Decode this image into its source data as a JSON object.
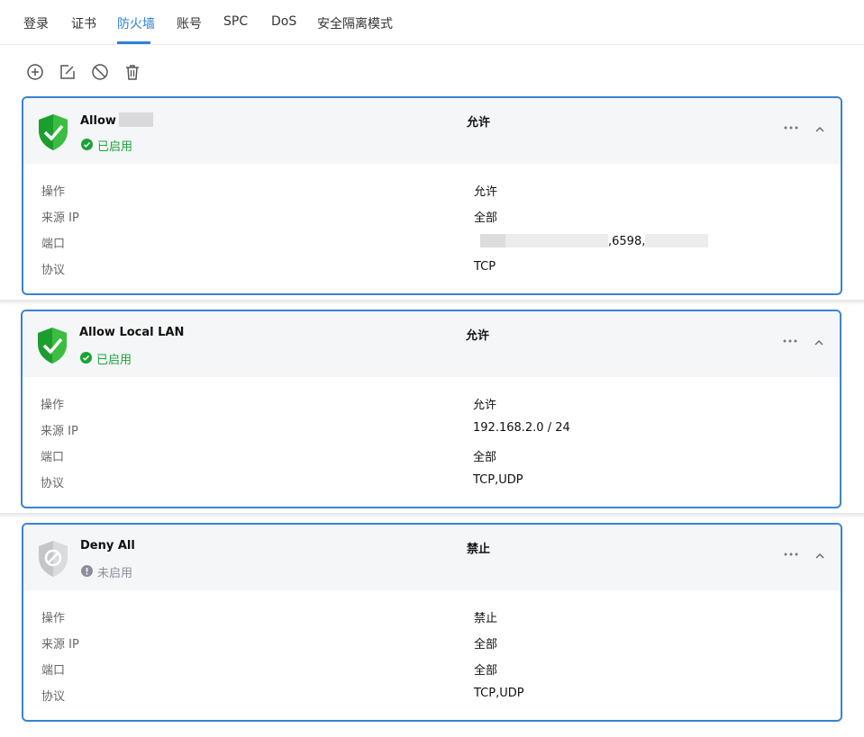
{
  "tabs": [
    {
      "label": "登录",
      "active": false
    },
    {
      "label": "证书",
      "active": false
    },
    {
      "label": "防火墙",
      "active": true
    },
    {
      "label": "账号",
      "active": false
    },
    {
      "label": "SPC",
      "active": false
    },
    {
      "label": "DoS",
      "active": false
    },
    {
      "label": "安全隔离模式",
      "active": false
    }
  ],
  "toolbar": {
    "icons": [
      "add-icon",
      "edit-icon",
      "disable-icon",
      "delete-icon"
    ]
  },
  "labels": {
    "action": "操作",
    "source_ip": "来源 IP",
    "port": "端口",
    "protocol": "协议"
  },
  "rules": [
    {
      "name": "Allow",
      "status": "已启用",
      "enabled": true,
      "header_action": "允许",
      "action": "允许",
      "source_ip": "全部",
      "port_visible": ",6598,",
      "protocol": "TCP"
    },
    {
      "name": "Allow Local LAN",
      "status": "已启用",
      "enabled": true,
      "header_action": "允许",
      "action": "允许",
      "source_ip": "192.168.2.0 / 24",
      "port": "全部",
      "protocol": "TCP,UDP"
    },
    {
      "name": "Deny All",
      "status": "未启用",
      "enabled": false,
      "header_action": "禁止",
      "action": "禁止",
      "source_ip": "全部",
      "port": "全部",
      "protocol": "TCP,UDP"
    }
  ],
  "colors": {
    "accent": "#2f80d8",
    "card_border": "#3b82d4",
    "enabled_green": "#1aa336",
    "disabled_gray": "#8a8f99"
  }
}
